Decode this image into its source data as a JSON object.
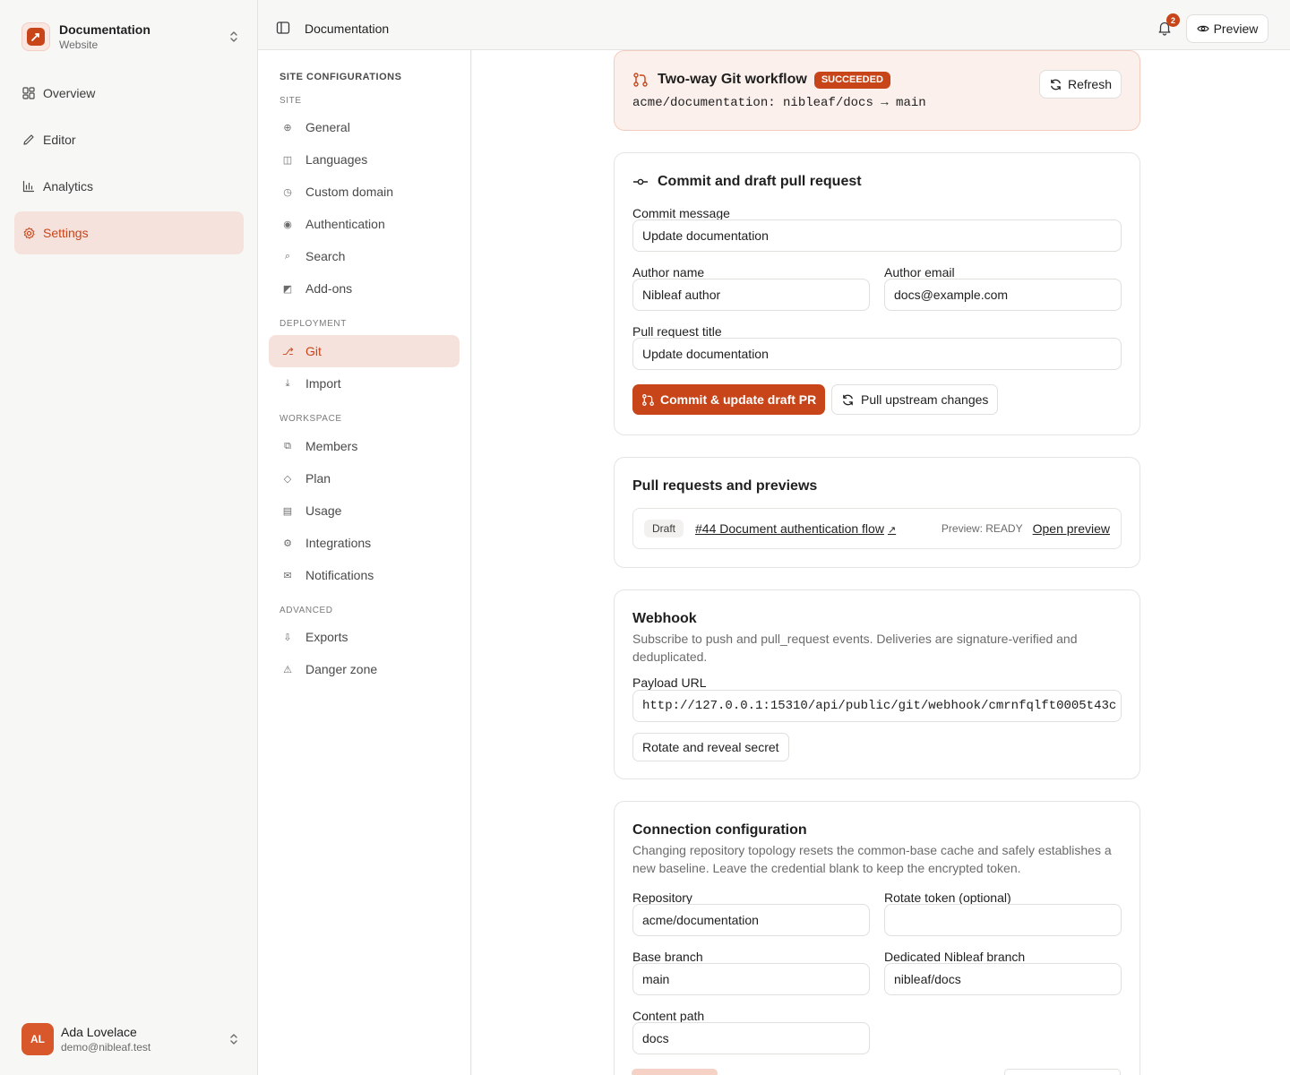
{
  "workspace": {
    "name": "Documentation",
    "type": "Website"
  },
  "nav": [
    {
      "label": "Overview",
      "icon": "grid-icon"
    },
    {
      "label": "Editor",
      "icon": "pencil-icon"
    },
    {
      "label": "Analytics",
      "icon": "bar-chart-icon"
    },
    {
      "label": "Settings",
      "icon": "gear-icon",
      "active": true
    }
  ],
  "user": {
    "initials": "AL",
    "name": "Ada Lovelace",
    "email": "demo@nibleaf.test"
  },
  "topbar": {
    "title": "Documentation",
    "notification_count": "2",
    "preview_label": "Preview"
  },
  "settings_nav": {
    "heading": "SITE CONFIGURATIONS",
    "groups": [
      {
        "label": "SITE",
        "items": [
          "General",
          "Languages",
          "Custom domain",
          "Authentication",
          "Search",
          "Add-ons"
        ]
      },
      {
        "label": "DEPLOYMENT",
        "items": [
          "Git",
          "Import"
        ]
      },
      {
        "label": "WORKSPACE",
        "items": [
          "Members",
          "Plan",
          "Usage",
          "Integrations",
          "Notifications"
        ]
      },
      {
        "label": "ADVANCED",
        "items": [
          "Exports",
          "Danger zone"
        ]
      }
    ],
    "active_item": "Git"
  },
  "git_workflow": {
    "title": "Two-way Git workflow",
    "status": "SUCCEEDED",
    "repo_line": "acme/documentation: nibleaf/docs → main",
    "refresh_label": "Refresh"
  },
  "commit": {
    "title": "Commit and draft pull request",
    "message_label": "Commit message",
    "message_value": "Update documentation",
    "author_name_label": "Author name",
    "author_name_value": "Nibleaf author",
    "author_email_label": "Author email",
    "author_email_value": "docs@example.com",
    "pr_title_label": "Pull request title",
    "pr_title_value": "Update documentation",
    "commit_button": "Commit & update draft PR",
    "pull_button": "Pull upstream changes"
  },
  "pull_requests": {
    "title": "Pull requests and previews",
    "items": [
      {
        "state": "Draft",
        "title": "#44 Document authentication flow",
        "preview_status": "Preview: READY",
        "open_label": "Open preview"
      }
    ]
  },
  "webhook": {
    "title": "Webhook",
    "description": "Subscribe to push and pull_request events. Deliveries are signature-verified and deduplicated.",
    "payload_label": "Payload URL",
    "payload_value": "http://127.0.0.1:15310/api/public/git/webhook/cmrnfqlft0005t43c",
    "rotate_button": "Rotate and reveal secret"
  },
  "connection": {
    "title": "Connection configuration",
    "description": "Changing repository topology resets the common-base cache and safely establishes a new baseline. Leave the credential blank to keep the encrypted token.",
    "repository_label": "Repository",
    "repository_value": "acme/documentation",
    "token_label": "Rotate token (optional)",
    "token_value": "",
    "base_branch_label": "Base branch",
    "base_branch_value": "main",
    "dedicated_branch_label": "Dedicated Nibleaf branch",
    "dedicated_branch_value": "nibleaf/docs",
    "content_path_label": "Content path",
    "content_path_value": "docs"
  },
  "colors": {
    "accent": "#c8451a",
    "accent_soft": "#f6e2dc",
    "border": "#e6e4e1"
  }
}
